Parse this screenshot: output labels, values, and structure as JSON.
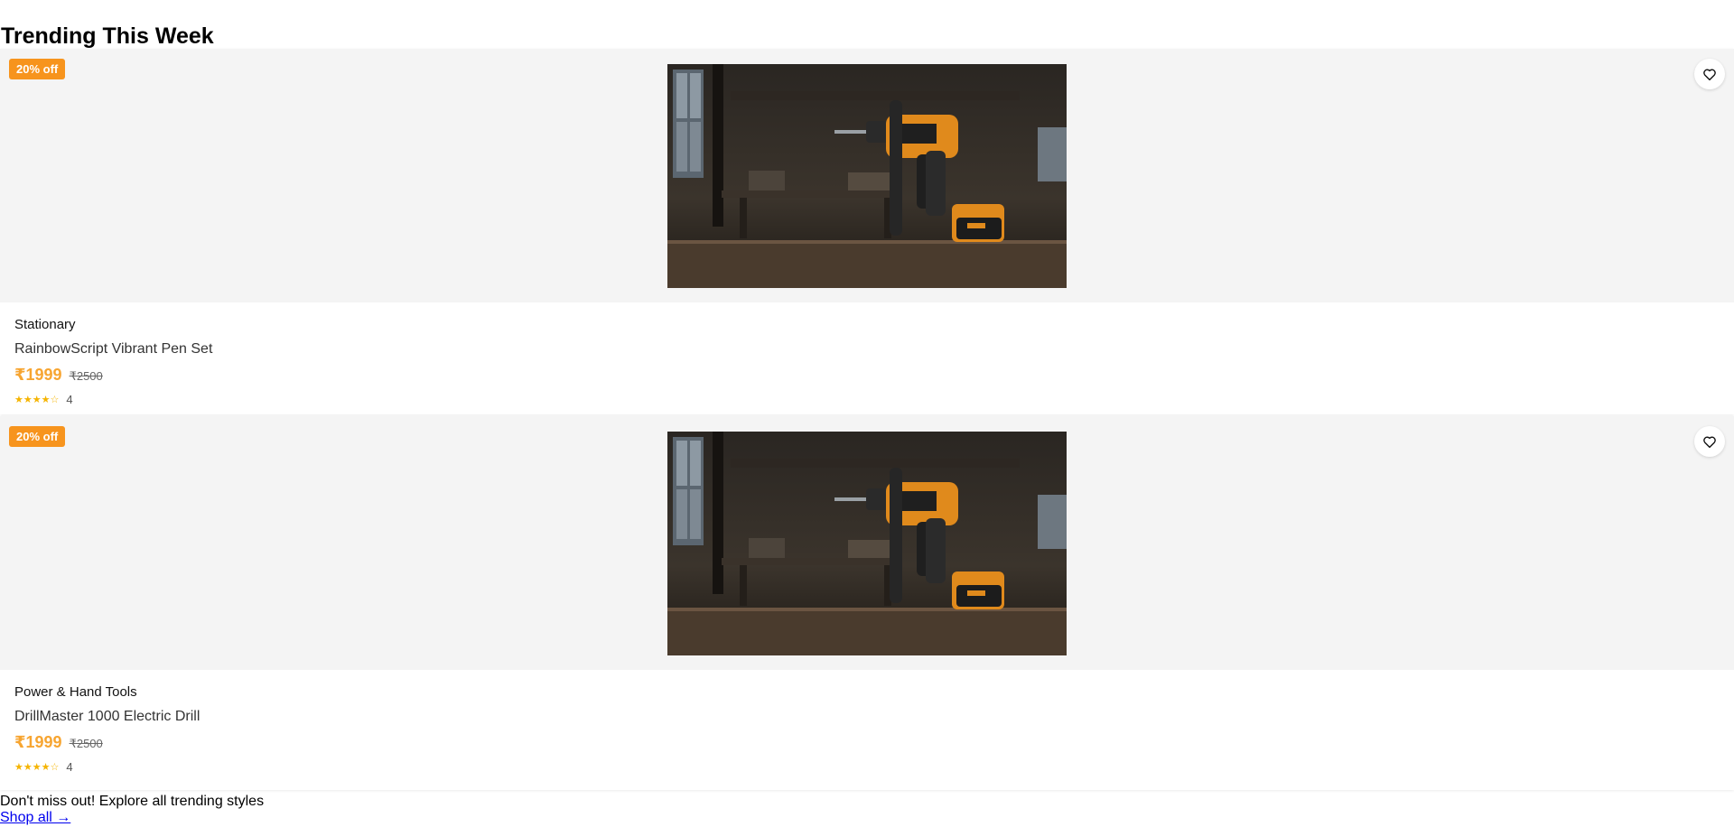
{
  "section": {
    "title": "Trending This Week"
  },
  "products": [
    {
      "discount_badge": "20% off",
      "category": "Stationary",
      "name": "RainbowScript Vibrant Pen Set",
      "price": "₹1999",
      "old_price": "₹2500",
      "stars": "★★★★☆",
      "rating": "4",
      "rating_value": 4,
      "rating_max": 5,
      "image_icon": "power-drill-photo",
      "wishlist_icon": "heart-icon"
    },
    {
      "discount_badge": "20% off",
      "category": "Power & Hand Tools",
      "name": "DrillMaster 1000 Electric Drill",
      "price": "₹1999",
      "old_price": "₹2500",
      "stars": "★★★★☆",
      "rating": "4",
      "rating_value": 4,
      "rating_max": 5,
      "image_icon": "power-drill-photo",
      "wishlist_icon": "heart-icon"
    }
  ],
  "footer": {
    "text": "Don't miss out! Explore all trending styles",
    "link_label": "Shop all →"
  },
  "colors": {
    "badge": "#f7941d",
    "price": "#f7a531",
    "stars": "#f5b400",
    "image_bg": "#f4f4f4",
    "link": "#0000ee"
  }
}
